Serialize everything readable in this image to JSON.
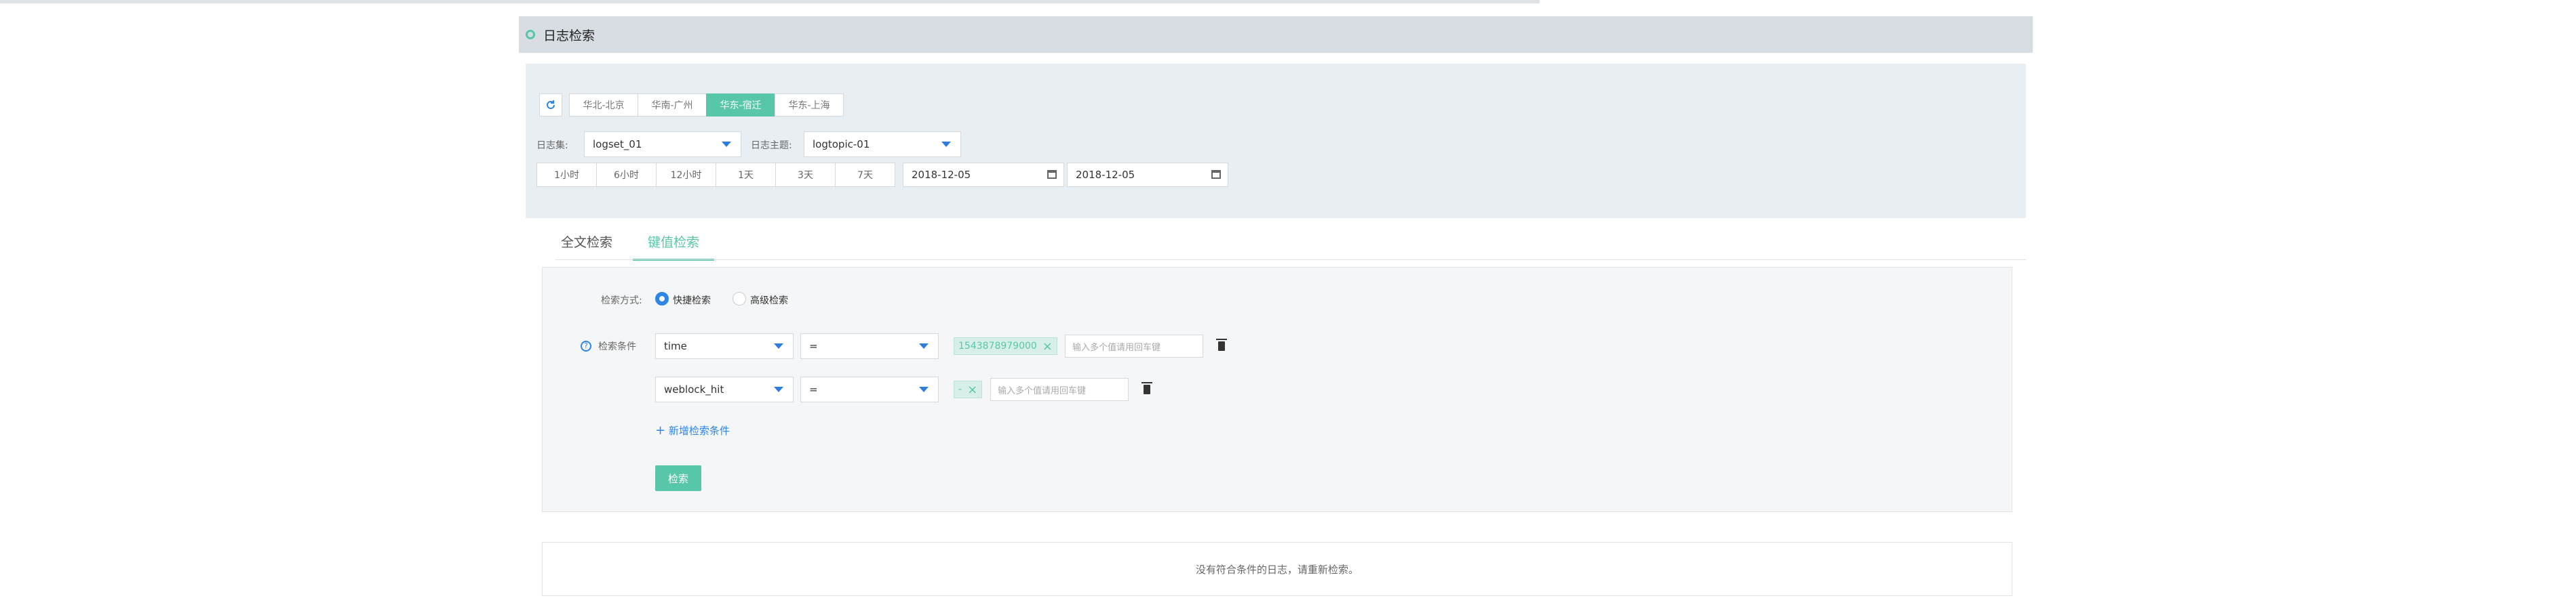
{
  "page": {
    "title": "日志检索"
  },
  "regions": [
    {
      "label": "华北-北京",
      "active": false
    },
    {
      "label": "华南-广州",
      "active": false
    },
    {
      "label": "华东-宿迁",
      "active": true
    },
    {
      "label": "华东-上海",
      "active": false
    }
  ],
  "filters": {
    "logset_label": "日志集:",
    "logset_value": "logset_01",
    "logtopic_label": "日志主题:",
    "logtopic_value": "logtopic-01"
  },
  "time_ranges": [
    "1小时",
    "6小时",
    "12小时",
    "1天",
    "3天",
    "7天"
  ],
  "dates": {
    "start": "2018-12-05",
    "end": "2018-12-05"
  },
  "tabs": [
    {
      "label": "全文检索",
      "active": false
    },
    {
      "label": "键值检索",
      "active": true
    }
  ],
  "query": {
    "mode_label": "检索方式:",
    "mode_quick": "快捷检索",
    "mode_advanced": "高级检索",
    "selected_mode": "快捷检索",
    "condition_label": "检索条件",
    "conditions": [
      {
        "field": "time",
        "operator": "=",
        "values": [
          "1543878979000"
        ],
        "placeholder": "输入多个值请用回车键"
      },
      {
        "field": "weblock_hit",
        "operator": "=",
        "values": [
          "-"
        ],
        "placeholder": "输入多个值请用回车键"
      }
    ],
    "add_label": "新增检索条件",
    "search_label": "检索"
  },
  "result": {
    "empty_message": "没有符合条件的日志，请重新检索。"
  }
}
